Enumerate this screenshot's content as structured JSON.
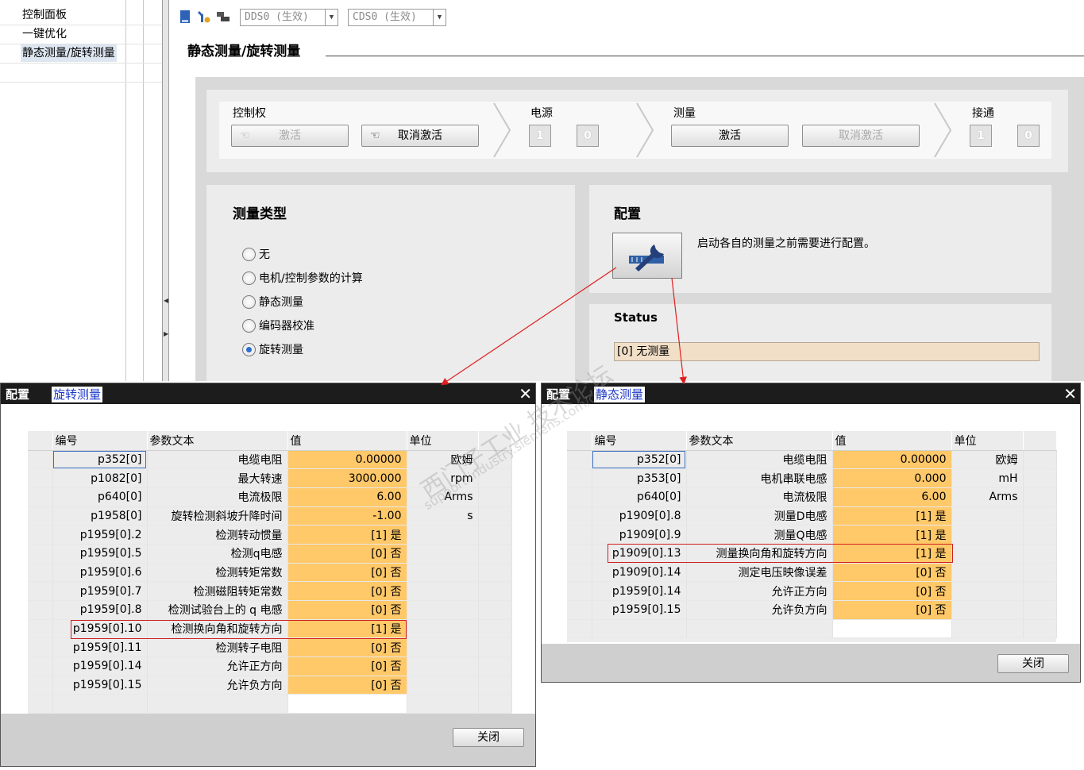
{
  "nav": {
    "items": [
      "控制面板",
      "一键优化",
      "静态测量/旋转测量"
    ],
    "selected_index": 2
  },
  "toolbar": {
    "dds_combo": "DDS0 (生效)",
    "cds_combo": "CDS0 (生效)"
  },
  "main": {
    "title": "静态测量/旋转测量",
    "control": {
      "control_label": "控制权",
      "activate": "激活",
      "deactivate": "取消激活",
      "power_label": "电源",
      "power_on": "1",
      "power_off": "0",
      "measure_label": "测量",
      "measure_activate": "激活",
      "measure_cancel": "取消激活",
      "enable_label": "接通",
      "enable_on": "1",
      "enable_off": "0"
    },
    "measure_type": {
      "heading": "测量类型",
      "options": [
        "无",
        "电机/控制参数的计算",
        "静态测量",
        "编码器校准",
        "旋转测量"
      ],
      "selected": 4
    },
    "config": {
      "heading": "配置",
      "hint": "启动各自的测量之前需要进行配置。"
    },
    "status": {
      "heading": "Status",
      "value": "[0] 无测量"
    }
  },
  "dialog_rotary": {
    "title": "配置",
    "subtitle": "旋转测量",
    "headers": [
      "编号",
      "参数文本",
      "值",
      "单位"
    ],
    "rows": [
      {
        "id": "p352[0]",
        "text": "电缆电阻",
        "value": "0.00000",
        "unit": "欧姆"
      },
      {
        "id": "p1082[0]",
        "text": "最大转速",
        "value": "3000.000",
        "unit": "rpm"
      },
      {
        "id": "p640[0]",
        "text": "电流极限",
        "value": "6.00",
        "unit": "Arms"
      },
      {
        "id": "p1958[0]",
        "text": "旋转检测斜坡升降时间",
        "value": "-1.00",
        "unit": "s"
      },
      {
        "id": "p1959[0].2",
        "text": "检测转动惯量",
        "value": "[1] 是",
        "unit": ""
      },
      {
        "id": "p1959[0].5",
        "text": "检测q电感",
        "value": "[0] 否",
        "unit": ""
      },
      {
        "id": "p1959[0].6",
        "text": "检测转矩常数",
        "value": "[0] 否",
        "unit": ""
      },
      {
        "id": "p1959[0].7",
        "text": "检测磁阻转矩常数",
        "value": "[0] 否",
        "unit": ""
      },
      {
        "id": "p1959[0].8",
        "text": "检测试验台上的 q 电感",
        "value": "[0] 否",
        "unit": ""
      },
      {
        "id": "p1959[0].10",
        "text": "检测换向角和旋转方向",
        "value": "[1] 是",
        "unit": ""
      },
      {
        "id": "p1959[0].11",
        "text": "检测转子电阻",
        "value": "[0] 否",
        "unit": ""
      },
      {
        "id": "p1959[0].14",
        "text": "允许正方向",
        "value": "[0] 否",
        "unit": ""
      },
      {
        "id": "p1959[0].15",
        "text": "允许负方向",
        "value": "[0] 否",
        "unit": ""
      }
    ],
    "close": "关闭"
  },
  "dialog_static": {
    "title": "配置",
    "subtitle": "静态测量",
    "headers": [
      "编号",
      "参数文本",
      "值",
      "单位"
    ],
    "rows": [
      {
        "id": "p352[0]",
        "text": "电缆电阻",
        "value": "0.00000",
        "unit": "欧姆"
      },
      {
        "id": "p353[0]",
        "text": "电机串联电感",
        "value": "0.000",
        "unit": "mH"
      },
      {
        "id": "p640[0]",
        "text": "电流极限",
        "value": "6.00",
        "unit": "Arms"
      },
      {
        "id": "p1909[0].8",
        "text": "测量D电感",
        "value": "[1] 是",
        "unit": ""
      },
      {
        "id": "p1909[0].9",
        "text": "测量Q电感",
        "value": "[1] 是",
        "unit": ""
      },
      {
        "id": "p1909[0].13",
        "text": "测量换向角和旋转方向",
        "value": "[1] 是",
        "unit": ""
      },
      {
        "id": "p1909[0].14",
        "text": "测定电压映像误差",
        "value": "[0] 否",
        "unit": ""
      },
      {
        "id": "p1959[0].14",
        "text": "允许正方向",
        "value": "[0] 否",
        "unit": ""
      },
      {
        "id": "p1959[0].15",
        "text": "允许负方向",
        "value": "[0] 否",
        "unit": ""
      }
    ],
    "close": "关闭"
  },
  "watermark": {
    "line1": "西门子工业   技术论坛",
    "line2": "support.industry.siemens.com/cs"
  },
  "colors": {
    "value_cell": "#ffc869",
    "highlight": "#d11f1f",
    "status_bg": "#f2dfc8",
    "titlebar": "#1c1c1c"
  }
}
